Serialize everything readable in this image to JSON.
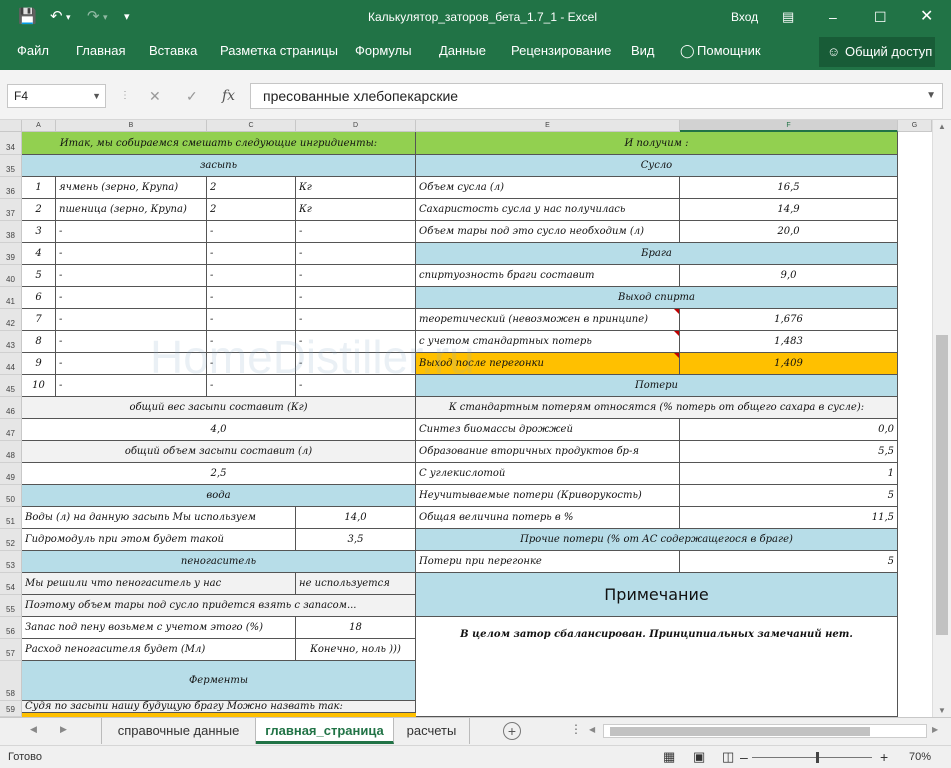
{
  "window": {
    "title": "Калькулятор_заторов_бета_1.7_1 - Excel",
    "signin": "Вход"
  },
  "ribbon": {
    "tabs": [
      "Файл",
      "Главная",
      "Вставка",
      "Разметка страницы",
      "Формулы",
      "Данные",
      "Рецензирование",
      "Вид"
    ],
    "assistant": "Помощник",
    "share": "Общий доступ"
  },
  "formula_bar": {
    "name_box": "F4",
    "fx": "fx",
    "content": "пресованные хлебопекарские"
  },
  "columns": [
    "A",
    "B",
    "C",
    "D",
    "E",
    "F",
    "G"
  ],
  "rows": [
    "34",
    "35",
    "36",
    "37",
    "38",
    "39",
    "40",
    "41",
    "42",
    "43",
    "44",
    "45",
    "46",
    "47",
    "48",
    "49",
    "50",
    "51",
    "52",
    "53",
    "54",
    "55",
    "56",
    "57",
    "58",
    "59"
  ],
  "left_block": {
    "title": "Итак, мы собираемся смешать следующие ингридиенты:",
    "grist_header": "засыпь",
    "ingredients": [
      {
        "n": "1",
        "name": "ячмень (зерно, Крупа)",
        "qty": "2",
        "unit": "Кг"
      },
      {
        "n": "2",
        "name": "пшеница (зерно, Крупа)",
        "qty": "2",
        "unit": "Кг"
      },
      {
        "n": "3",
        "name": "-",
        "qty": "-",
        "unit": "-"
      },
      {
        "n": "4",
        "name": "-",
        "qty": "-",
        "unit": "-"
      },
      {
        "n": "5",
        "name": "-",
        "qty": "-",
        "unit": "-"
      },
      {
        "n": "6",
        "name": "-",
        "qty": "-",
        "unit": "-"
      },
      {
        "n": "7",
        "name": "-",
        "qty": "-",
        "unit": "-"
      },
      {
        "n": "8",
        "name": "-",
        "qty": "-",
        "unit": "-"
      },
      {
        "n": "9",
        "name": "-",
        "qty": "-",
        "unit": "-"
      },
      {
        "n": "10",
        "name": "-",
        "qty": "-",
        "unit": "-"
      }
    ],
    "total_weight_label": "общий вес засыпи составит (Кг)",
    "total_weight": "4,0",
    "total_volume_label": "общий объем засыпи составит (л)",
    "total_volume": "2,5",
    "water_header": "вода",
    "water_label": "Воды (л)  на данную засыпь Мы используем",
    "water_value": "14,0",
    "hydromodule_label": "Гидромодуль при этом будет такой",
    "hydromodule_value": "3,5",
    "antifoam_header": "пеногаситель",
    "antifoam_label": "Мы решили что пеногаситель  у нас",
    "antifoam_value": "не используется",
    "tank_note": "Поэтому объем тары под сусло придется взять с запасом...",
    "foam_reserve_label": "Запас под пену возьмем с учетом этого  (%)",
    "foam_reserve_value": "18",
    "antifoam_use_label": "Расход пеногасителя будет (Мл)",
    "antifoam_use_value": "Конечно, ноль )))",
    "enzymes_header": "Ферменты",
    "brew_name_label": "Судя по засыпи нашу будущую брагу Можно назвать так:"
  },
  "right_block": {
    "title": "И получим :",
    "wort_header": "Сусло",
    "wort_rows": [
      {
        "label": "Объем сусла (л)",
        "value": "16,5"
      },
      {
        "label": "Сахаристость сусла у нас получилась",
        "value": "14,9"
      },
      {
        "label": "Объем тары под это сусло необходим (л)",
        "value": "20,0"
      }
    ],
    "mash_header": "Брага",
    "mash_rows": [
      {
        "label": "спиртуозность браги составит",
        "value": "9,0"
      }
    ],
    "yield_header": "Выход спирта",
    "yield_rows": [
      {
        "label": "теоретический (невозможен в принципе)",
        "value": "1,676"
      },
      {
        "label": "с учетом стандартных потерь",
        "value": "1,483"
      },
      {
        "label": "Выход после перегонки",
        "value": "1,409"
      }
    ],
    "losses_header": "Потери",
    "losses_subheader": "К стандартным потерям относятся (% потерь от общего сахара в сусле):",
    "losses_rows": [
      {
        "label": "Синтез биомассы дрожжей",
        "value": "0,0"
      },
      {
        "label": "Образование вторичных продуктов бр-я",
        "value": "5,5"
      },
      {
        "label": "С углекислотой",
        "value": "1"
      },
      {
        "label": "Неучитываемые  потери (Криворукость)",
        "value": "5"
      },
      {
        "label": "Общая величина потерь в %",
        "value": "11,5"
      }
    ],
    "other_losses_header": "Прочие потери (% от АС содержащегося в браге)",
    "distill_loss_label": "Потери при перегонке",
    "distill_loss_value": "5",
    "note_title": "Примечание",
    "note_text": "В целом затор сбалансирован. Принципиальных замечаний нет."
  },
  "watermark": "HomeDistiller.ru",
  "sheets": {
    "tabs": [
      "справочные данные",
      "главная_страница",
      "расчеты"
    ],
    "active": "главная_страница"
  },
  "status": {
    "ready": "Готово",
    "zoom": "70%"
  },
  "colors": {
    "excel_green": "#217346",
    "header_green": "#92d050",
    "section_blue": "#b7dde8",
    "highlight_orange": "#ffc000",
    "comment_red": "#c00000"
  }
}
